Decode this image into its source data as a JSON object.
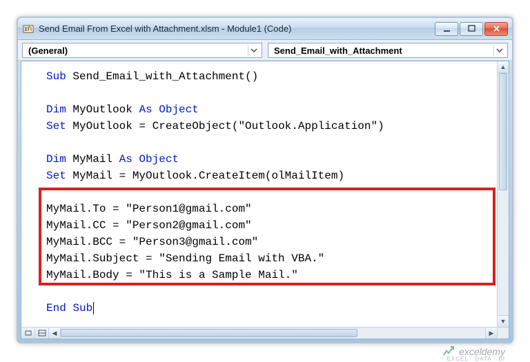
{
  "window": {
    "title": "Send Email From Excel with Attachment.xlsm - Module1 (Code)"
  },
  "dropdowns": {
    "object": "(General)",
    "procedure": "Send_Email_with_Attachment"
  },
  "code": {
    "line1_a": "Sub",
    "line1_b": " Send_Email_with_Attachment()",
    "line3_a": "Dim",
    "line3_b": " MyOutlook ",
    "line3_c": "As Object",
    "line4_a": "Set",
    "line4_b": " MyOutlook = CreateObject(\"Outlook.Application\")",
    "line6_a": "Dim",
    "line6_b": " MyMail ",
    "line6_c": "As Object",
    "line7_a": "Set",
    "line7_b": " MyMail = MyOutlook.CreateItem(olMailItem)",
    "line9": "MyMail.To = \"Person1@gmail.com\"",
    "line10": "MyMail.CC = \"Person2@gmail.com\"",
    "line11": "MyMail.BCC = \"Person3@gmail.com\"",
    "line12": "MyMail.Subject = \"Sending Email with VBA.\"",
    "line13": "MyMail.Body = \"This is a Sample Mail.\"",
    "line15": "End Sub"
  },
  "watermark": {
    "text": "exceldemy",
    "sub": "EXCEL · DATA · BI"
  }
}
